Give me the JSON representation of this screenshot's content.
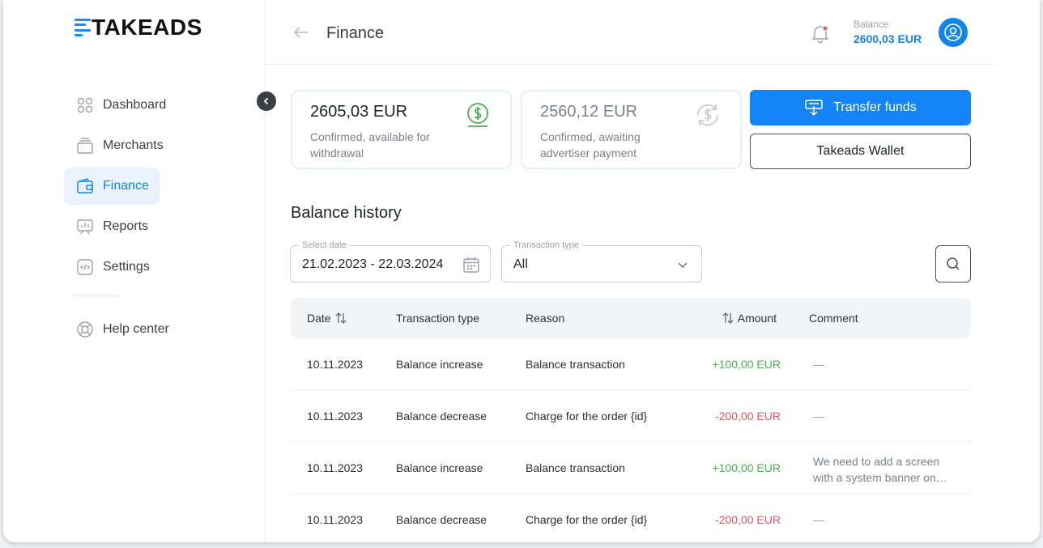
{
  "brand": {
    "logo_text": "TAKEADS",
    "accent": "#1485e8"
  },
  "sidebar": {
    "items": [
      {
        "label": "Dashboard",
        "icon": "grid-circles-icon"
      },
      {
        "label": "Merchants",
        "icon": "stack-icon"
      },
      {
        "label": "Finance",
        "icon": "wallet-icon",
        "active": true
      },
      {
        "label": "Reports",
        "icon": "chart-board-icon"
      },
      {
        "label": "Settings",
        "icon": "code-window-icon"
      }
    ],
    "help": {
      "label": "Help center",
      "icon": "lifebuoy-icon"
    }
  },
  "header": {
    "title": "Finance",
    "balance_label": "Balance",
    "balance_value": "2600,03 EUR"
  },
  "cards": [
    {
      "amount": "2605,03 EUR",
      "description": "Confirmed, available for withdrawal",
      "icon": "dollar-coin-icon",
      "color": "#4caf50"
    },
    {
      "amount": "2560,12 EUR",
      "description": "Confirmed, awaiting advertiser payment",
      "icon": "dollar-refresh-icon",
      "color": "#c7ccd3"
    }
  ],
  "actions": {
    "transfer_label": "Transfer funds",
    "wallet_label": "Takeads Wallet"
  },
  "history": {
    "title": "Balance history",
    "date_filter": {
      "label": "Select date",
      "value": "21.02.2023 - 22.03.2024"
    },
    "type_filter": {
      "label": "Transaction type",
      "value": "All"
    },
    "columns": {
      "date": "Date",
      "type": "Transaction type",
      "reason": "Reason",
      "amount": "Amount",
      "comment": "Comment"
    },
    "rows": [
      {
        "date": "10.11.2023",
        "type": "Balance increase",
        "reason": "Balance transaction",
        "amount": "+100,00 EUR",
        "sign": "pos",
        "comment": "—"
      },
      {
        "date": "10.11.2023",
        "type": "Balance decrease",
        "reason": "Charge for the order {id}",
        "amount": "-200,00 EUR",
        "sign": "neg",
        "comment": "—"
      },
      {
        "date": "10.11.2023",
        "type": "Balance increase",
        "reason": "Balance transaction",
        "amount": "+100,00 EUR",
        "sign": "pos",
        "comment": "We need to add a screen with a system banner on…"
      },
      {
        "date": "10.11.2023",
        "type": "Balance decrease",
        "reason": "Charge for the order {id}",
        "amount": "-200,00 EUR",
        "sign": "neg",
        "comment": "—"
      }
    ]
  }
}
